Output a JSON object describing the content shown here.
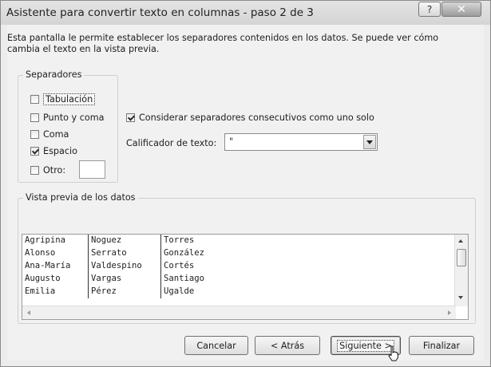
{
  "window": {
    "title": "Asistente para convertir texto en columnas - paso 2 de 3",
    "help_glyph": "?",
    "close_glyph": "✕"
  },
  "description": "Esta pantalla le permite establecer los separadores contenidos en los datos. Se puede ver cómo cambia el texto en la vista previa.",
  "separators": {
    "legend": "Separadores",
    "items": [
      {
        "label": "Tabulación",
        "checked": false
      },
      {
        "label": "Punto y coma",
        "checked": false
      },
      {
        "label": "Coma",
        "checked": false
      },
      {
        "label": "Espacio",
        "checked": true
      },
      {
        "label": "Otro:",
        "checked": false
      }
    ],
    "other_value": ""
  },
  "consecutive": {
    "label": "Considerar separadores consecutivos como uno solo",
    "checked": true
  },
  "qualifier": {
    "label": "Calificador de texto:",
    "value": "\""
  },
  "preview": {
    "legend": "Vista previa de los datos",
    "rows": [
      [
        "Agripina",
        "Noguez",
        "Torres"
      ],
      [
        "Alonso",
        "Serrato",
        "González"
      ],
      [
        "Ana-María",
        "Valdespino",
        "Cortés"
      ],
      [
        "Augusto",
        "Vargas",
        "Santiago"
      ],
      [
        "Emilia",
        "Pérez",
        "Ugalde"
      ]
    ]
  },
  "buttons": {
    "cancel": "Cancelar",
    "back": "< Atrás",
    "next": "Siguiente >",
    "finish": "Finalizar"
  }
}
